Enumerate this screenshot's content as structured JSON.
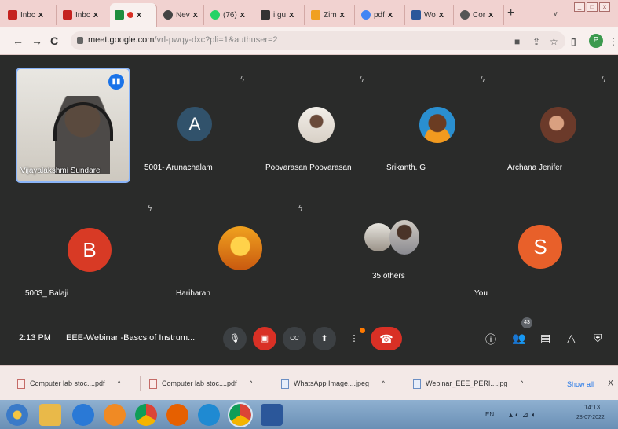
{
  "browser": {
    "tabs": [
      {
        "label": "Inbc",
        "fav": "#c5221f"
      },
      {
        "label": "Inbc",
        "fav": "#c5221f"
      },
      {
        "label": "·",
        "fav": "#1e8e3e"
      },
      {
        "label": "Nev",
        "fav": "#444444"
      },
      {
        "label": "(76)",
        "fav": "#25d366"
      },
      {
        "label": "i gu",
        "fav": "#333333"
      },
      {
        "label": "Zim",
        "fav": "#f0a020"
      },
      {
        "label": "pdf",
        "fav": "#4285f4"
      },
      {
        "label": "Wo",
        "fav": "#2b579a"
      },
      {
        "label": "Cor",
        "fav": "#555555"
      }
    ],
    "tab_close": "x",
    "new_tab": "+",
    "tab_menu": "v",
    "url_host": "meet.google.com",
    "url_path": "/vrl-pwqy-dxc?pli=1&authuser=2",
    "profile_initial": "P"
  },
  "meet": {
    "self_name": "Vijayalakshmi Sundare",
    "participants": [
      {
        "name": "5001- Arunachalam",
        "initial": "A",
        "color": "#31526b"
      },
      {
        "name": "Poovarasan Poovarasan",
        "initial": "",
        "color": "#e8e2dc"
      },
      {
        "name": "Srikanth. G",
        "initial": "",
        "color": "#2a8fd0"
      },
      {
        "name": "Archana Jenifer",
        "initial": "",
        "color": "#6b3a2a"
      },
      {
        "name": "5003_ Balaji",
        "initial": "B",
        "color": "#d83a25"
      },
      {
        "name": "Hariharan",
        "initial": "",
        "color": "#e09a1f"
      },
      {
        "name": "You",
        "initial": "S",
        "color": "#e8602a"
      }
    ],
    "others_label": "35 others",
    "clock": "2:13 PM",
    "meeting_title": "EEE-Webinar -Bascs of Instrum...",
    "people_count": "43"
  },
  "downloads": {
    "items": [
      {
        "label": "Computer lab stoc....pdf",
        "kind": "pdf"
      },
      {
        "label": "Computer lab stoc....pdf",
        "kind": "pdf"
      },
      {
        "label": "WhatsApp Image....jpeg",
        "kind": "img"
      },
      {
        "label": "Webinar_EEE_PERI....jpg",
        "kind": "img"
      }
    ],
    "show_all": "Show all",
    "close": "X"
  },
  "taskbar": {
    "lang": "EN",
    "time": "14:13",
    "date": "28-07-2022"
  }
}
